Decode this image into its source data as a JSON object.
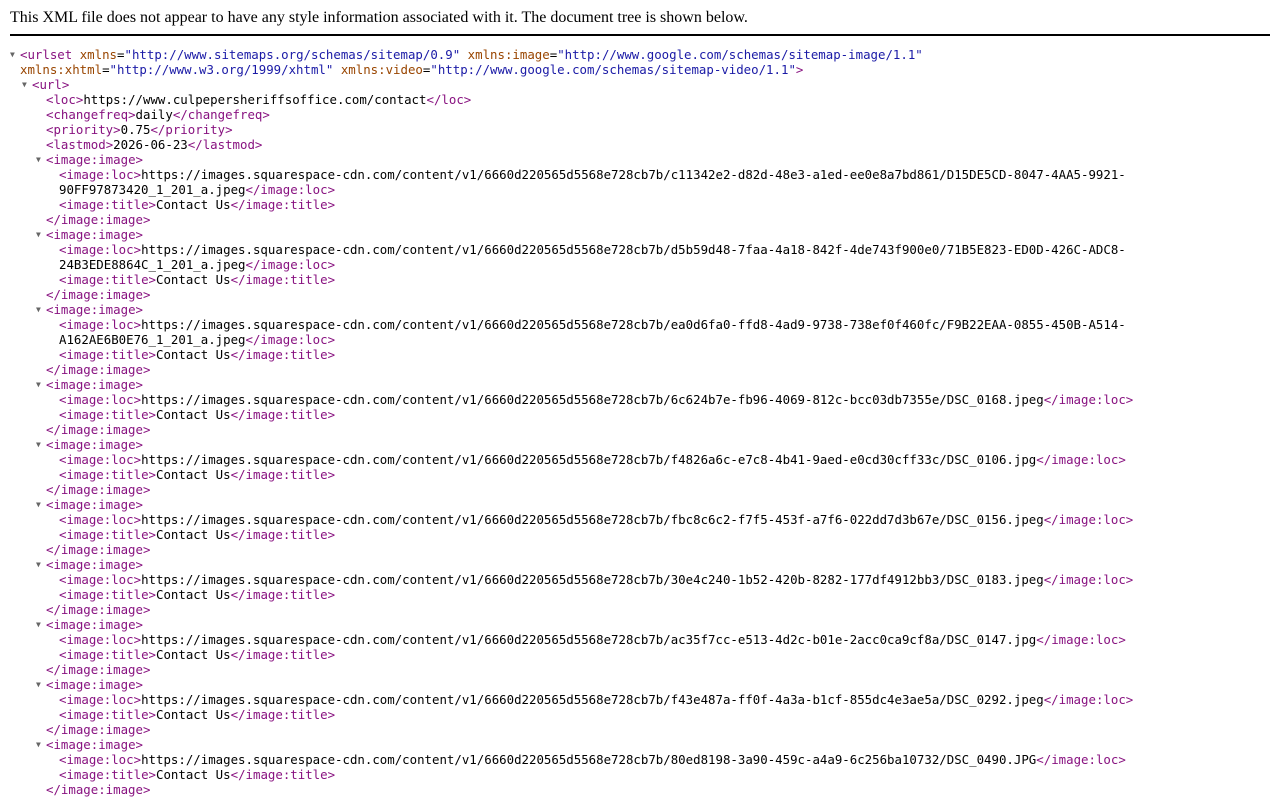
{
  "header": {
    "message": "This XML file does not appear to have any style information associated with it. The document tree is shown below."
  },
  "toggle_glyph": "▼",
  "urlset": {
    "tag": "urlset",
    "xmlns_attr": "xmlns",
    "xmlns": "http://www.sitemaps.org/schemas/sitemap/0.9",
    "image_attr": "xmlns:image",
    "image_ns": "http://www.google.com/schemas/sitemap-image/1.1",
    "xhtml_attr": "xmlns:xhtml",
    "xhtml_ns": "http://www.w3.org/1999/xhtml",
    "video_attr": "xmlns:video",
    "video_ns": "http://www.google.com/schemas/sitemap-video/1.1"
  },
  "url": {
    "tag": "url",
    "loc_tag": "loc",
    "loc": "https://www.culpepersheriffsoffice.com/contact",
    "changefreq_tag": "changefreq",
    "changefreq": "daily",
    "priority_tag": "priority",
    "priority": "0.75",
    "lastmod_tag": "lastmod",
    "lastmod": "2026-06-23"
  },
  "image_tag": "image:image",
  "image_loc_tag": "image:loc",
  "image_title_tag": "image:title",
  "images": [
    {
      "loc_part1": "https://images.squarespace-cdn.com/content/v1/6660d220565d5568e728cb7b/c11342e2-d82d-48e3-a1ed-ee0e8a7bd861/D15DE5CD-8047-4AA5-9921-",
      "loc_part2": "90FF97873420_1_201_a.jpeg",
      "title": "Contact Us"
    },
    {
      "loc_part1": "https://images.squarespace-cdn.com/content/v1/6660d220565d5568e728cb7b/d5b59d48-7faa-4a18-842f-4de743f900e0/71B5E823-ED0D-426C-ADC8-",
      "loc_part2": "24B3EDE8864C_1_201_a.jpeg",
      "title": "Contact Us"
    },
    {
      "loc_part1": "https://images.squarespace-cdn.com/content/v1/6660d220565d5568e728cb7b/ea0d6fa0-ffd8-4ad9-9738-738ef0f460fc/F9B22EAA-0855-450B-A514-",
      "loc_part2": "A162AE6B0E76_1_201_a.jpeg",
      "title": "Contact Us"
    },
    {
      "loc_part1": "https://images.squarespace-cdn.com/content/v1/6660d220565d5568e728cb7b/6c624b7e-fb96-4069-812c-bcc03db7355e/DSC_0168.jpeg",
      "loc_part2": "",
      "title": "Contact Us"
    },
    {
      "loc_part1": "https://images.squarespace-cdn.com/content/v1/6660d220565d5568e728cb7b/f4826a6c-e7c8-4b41-9aed-e0cd30cff33c/DSC_0106.jpg",
      "loc_part2": "",
      "title": "Contact Us"
    },
    {
      "loc_part1": "https://images.squarespace-cdn.com/content/v1/6660d220565d5568e728cb7b/fbc8c6c2-f7f5-453f-a7f6-022dd7d3b67e/DSC_0156.jpeg",
      "loc_part2": "",
      "title": "Contact Us"
    },
    {
      "loc_part1": "https://images.squarespace-cdn.com/content/v1/6660d220565d5568e728cb7b/30e4c240-1b52-420b-8282-177df4912bb3/DSC_0183.jpeg",
      "loc_part2": "",
      "title": "Contact Us"
    },
    {
      "loc_part1": "https://images.squarespace-cdn.com/content/v1/6660d220565d5568e728cb7b/ac35f7cc-e513-4d2c-b01e-2acc0ca9cf8a/DSC_0147.jpg",
      "loc_part2": "",
      "title": "Contact Us"
    },
    {
      "loc_part1": "https://images.squarespace-cdn.com/content/v1/6660d220565d5568e728cb7b/f43e487a-ff0f-4a3a-b1cf-855dc4e3ae5a/DSC_0292.jpeg",
      "loc_part2": "",
      "title": "Contact Us"
    },
    {
      "loc_part1": "https://images.squarespace-cdn.com/content/v1/6660d220565d5568e728cb7b/80ed8198-3a90-459c-a4a9-6c256ba10732/DSC_0490.JPG",
      "loc_part2": "",
      "title": "Contact Us"
    }
  ],
  "colors": {
    "tag": "#881280",
    "attribute_name": "#994500",
    "attribute_value": "#1a1aa6",
    "text": "#000000",
    "toggle": "#666666"
  }
}
